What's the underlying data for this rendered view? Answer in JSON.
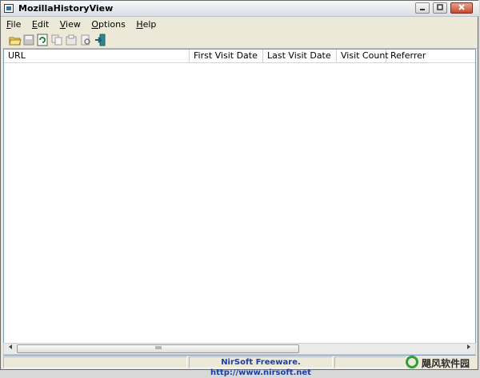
{
  "window": {
    "title": "MozillaHistoryView"
  },
  "title_buttons": [
    "minimize",
    "maximize",
    "close"
  ],
  "menu": [
    {
      "label": "File",
      "accel": "F",
      "rest": "ile"
    },
    {
      "label": "Edit",
      "accel": "E",
      "rest": "dit"
    },
    {
      "label": "View",
      "accel": "V",
      "rest": "iew"
    },
    {
      "label": "Options",
      "accel": "O",
      "rest": "ptions"
    },
    {
      "label": "Help",
      "accel": "H",
      "rest": "elp"
    }
  ],
  "toolbar_icons": [
    "open-folder-icon",
    "save-icon",
    "refresh-icon",
    "copy-icon",
    "properties-icon",
    "find-icon",
    "exit-icon"
  ],
  "columns": [
    "URL",
    "First Visit Date",
    "Last Visit Date",
    "Visit Count",
    "Referrer"
  ],
  "rows": [],
  "status": {
    "left": "",
    "link": "NirSoft Freeware.  http://www.nirsoft.net",
    "right": ""
  },
  "watermark": "飓风软件园",
  "colors": {
    "accent": "#1a3fa7",
    "close_button": "#c64a2f",
    "watermark_green": "#2aa036"
  }
}
